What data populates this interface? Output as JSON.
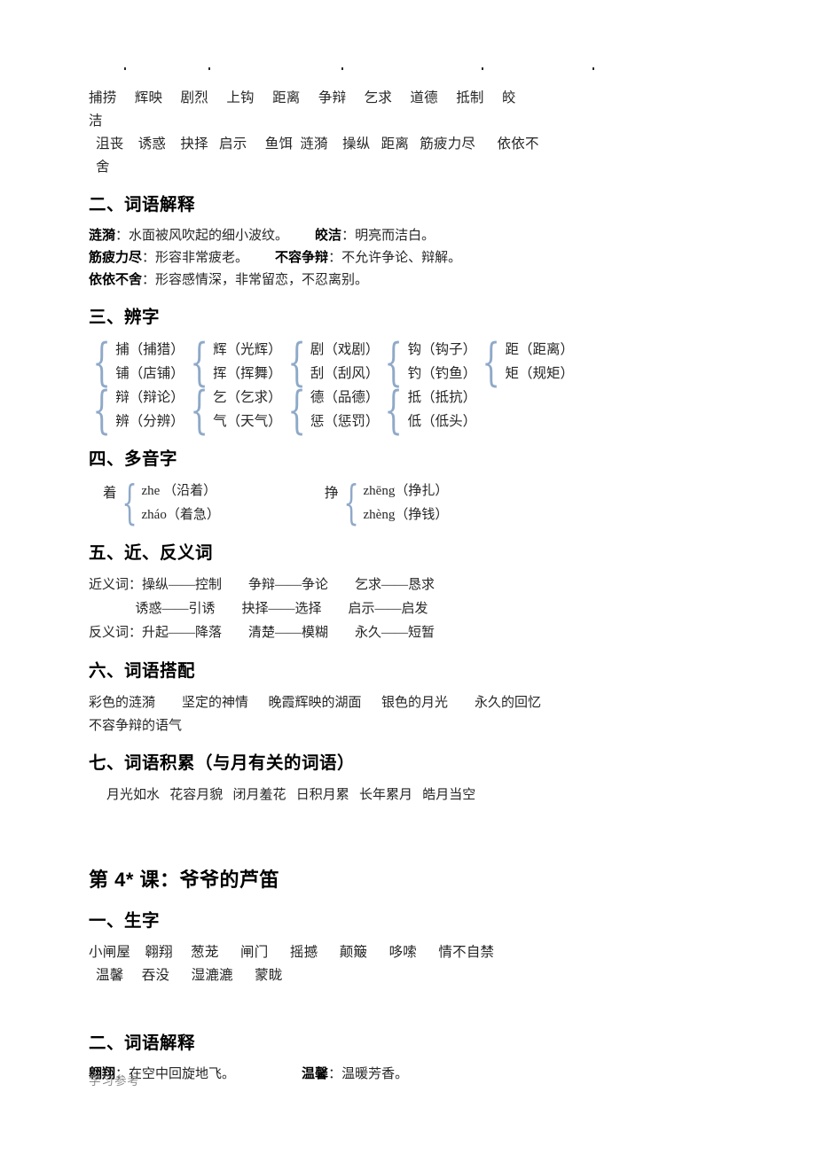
{
  "page": {
    "artifact_dots_x": [
      140,
      235,
      385,
      543,
      668
    ],
    "footer": "学习参考"
  },
  "lesson3": {
    "vocab": {
      "line1": "捕捞     辉映     剧烈     上钩     距离     争辩     乞求     道德     抵制     皎",
      "line1_wrap": "洁",
      "line2": "沮丧    诱惑    抉择   启示     鱼饵  涟漪    操纵   距离   筋疲力尽      依依不",
      "line2_wrap": "舍"
    },
    "headings": {
      "ci_yu_jie_shi": "二、词语解释",
      "bian_zi": "三、辨字",
      "duo_yin_zi": "四、多音字",
      "jin_fan_yi_ci": "五、近、反义词",
      "ci_yu_da_pei": "六、词语搭配",
      "ci_yu_ji_lei": "七、词语积累（与月有关的词语）"
    },
    "definitions": [
      {
        "term1": "涟漪",
        "def1": "水面被风吹起的细小波纹。",
        "gap": "        ",
        "term2": "皎洁",
        "def2": "明亮而洁白。"
      },
      {
        "term1": "筋疲力尽",
        "def1": "形容非常疲老。",
        "gap": "        ",
        "term2": "不容争辩",
        "def2": "不允许争论、辩解。"
      },
      {
        "term1": "依依不舍",
        "def1": "形容感情深，非常留恋，不忍离别。",
        "gap": "",
        "term2": "",
        "def2": ""
      }
    ],
    "bianzi": {
      "group_top": [
        {
          "top": "捕（捕猎）",
          "bottom": "铺（店铺）"
        },
        {
          "top": "辉（光辉）",
          "bottom": "挥（挥舞）"
        },
        {
          "top": "剧（戏剧）",
          "bottom": "刮（刮风）"
        },
        {
          "top": "钩（钩子）",
          "bottom": "钓（钓鱼）"
        },
        {
          "top": "距（距离）",
          "bottom": "矩（规矩）"
        }
      ],
      "group_bottom": [
        {
          "top": "辩（辩论）",
          "bottom": "辨（分辨）"
        },
        {
          "top": "乞（乞求）",
          "bottom": "气（天气）"
        },
        {
          "top": "德（品德）",
          "bottom": "惩（惩罚）"
        },
        {
          "top": "抵（抵抗）",
          "bottom": "低（低头）"
        }
      ]
    },
    "duoyinzi": [
      {
        "char": "着",
        "r1": "zhe （沿着）",
        "r2": "zháo（着急）"
      },
      {
        "char": "挣",
        "r1": "zhēng（挣扎）",
        "r2": "zhèng（挣钱）"
      }
    ],
    "synonyms": {
      "label_syn": "近义词：",
      "label_ant": "反义词：",
      "row1": "近义词：操纵——控制        争辩——争论        乞求——恳求",
      "row2": "              诱惑——引诱        抉择——选择        启示——启发",
      "row3": "反义词：升起——降落        清楚——模糊        永久——短暂"
    },
    "collocation": {
      "row1": "彩色的涟漪        坚定的神情      晚霞辉映的湖面      银色的月光        永久的回忆",
      "row2": "不容争辩的语气"
    },
    "accumulation": {
      "row1": "月光如水   花容月貌   闭月羞花   日积月累   长年累月   皓月当空"
    }
  },
  "lesson4": {
    "title": "第 4* 课：爷爷的芦笛",
    "headings": {
      "sheng_zi": "一、生字",
      "ci_yu_jie_shi": "二、词语解释"
    },
    "vocab": {
      "line1": "小闸屋    翱翔     葱茏      闸门      摇撼      颠簸      哆嗦      情不自禁",
      "line2": "温馨     吞没      湿漉漉      蒙眬"
    },
    "definitions": [
      {
        "term1": "翱翔",
        "def1": "在空中回旋地飞。",
        "gap": "                    ",
        "term2": "温馨",
        "def2": "温暖芳香。"
      }
    ]
  }
}
